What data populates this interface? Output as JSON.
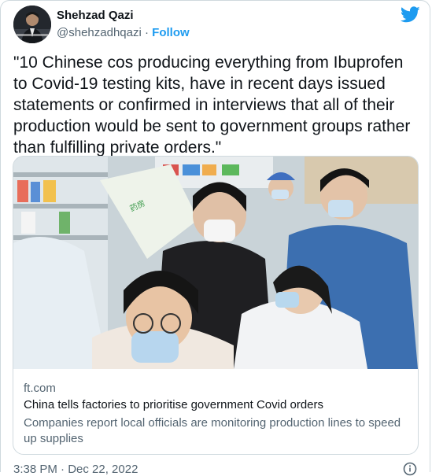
{
  "author": {
    "name": "Shehzad Qazi",
    "handle": "@shehzadhqazi",
    "separator": "·",
    "follow_label": "Follow"
  },
  "tweet": {
    "text": "\"10 Chinese cos producing everything from Ibuprofen to Covid-19 testing kits, have in recent days issued statements or confirmed in interviews that all of their production would be sent to government groups rather than fulfilling private orders.\"",
    "timestamp": "3:38 PM · Dec 22, 2022"
  },
  "link_card": {
    "domain": "ft.com",
    "title": "China tells factories to prioritise government Covid orders",
    "description": "Companies report local officials are monitoring production lines to speed up supplies",
    "image_description_icon": "pharmacy-crowd-photo"
  },
  "icons": {
    "brand": "twitter-bird-icon",
    "info": "info-icon"
  },
  "colors": {
    "accent": "#1d9bf0",
    "text": "#0f1419",
    "secondary": "#536471",
    "border": "#cfd9de"
  }
}
